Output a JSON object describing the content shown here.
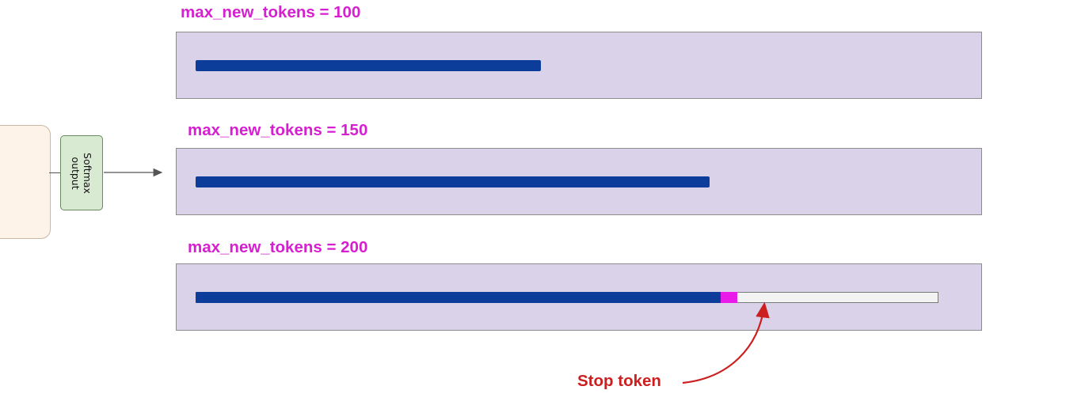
{
  "softmax": {
    "label": "Softmax\noutput"
  },
  "scenarios": [
    {
      "label": "max_new_tokens = 100",
      "max_new_tokens": 100,
      "generated_fraction": 0.465
    },
    {
      "label": "max_new_tokens = 150",
      "max_new_tokens": 150,
      "generated_fraction": 0.692
    },
    {
      "label": "max_new_tokens = 200",
      "max_new_tokens": 200,
      "generated_fraction": 0.707,
      "stop_token": true
    }
  ],
  "stop_token": {
    "label": "Stop token",
    "color": "#cc1f1f",
    "marker_color": "#ea1bea"
  },
  "colors": {
    "label": "#d61fd0",
    "bar": "#0d3d9a",
    "panel": "#d9d2e9",
    "softmax_box": "#d9ead3",
    "model_block": "#fdf3e9"
  }
}
